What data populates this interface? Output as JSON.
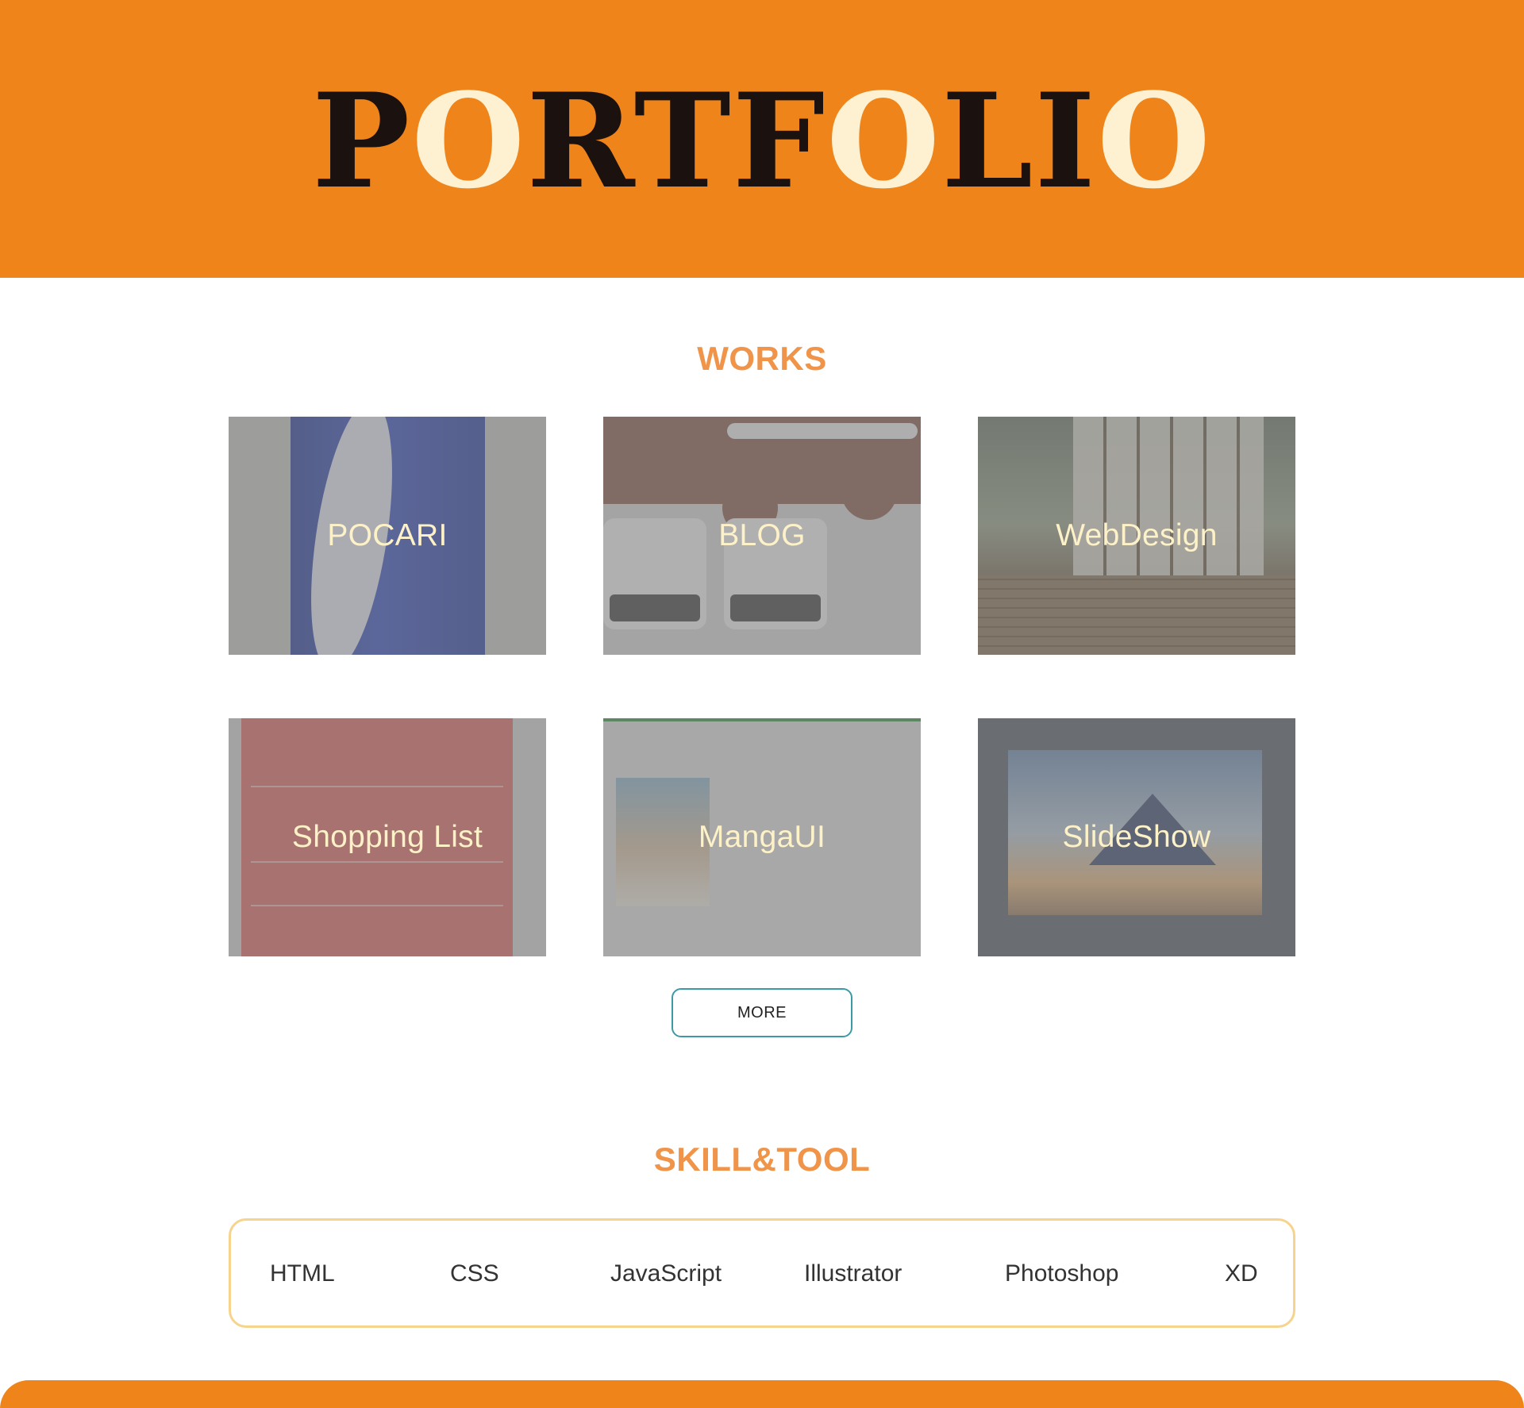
{
  "header": {
    "title_parts": [
      {
        "text": "P",
        "highlight": false
      },
      {
        "text": "O",
        "highlight": true
      },
      {
        "text": "RTF",
        "highlight": false
      },
      {
        "text": "O",
        "highlight": true
      },
      {
        "text": "LI",
        "highlight": false
      },
      {
        "text": "O",
        "highlight": true
      }
    ]
  },
  "works": {
    "title": "WORKS",
    "items": [
      {
        "label": "POCARI"
      },
      {
        "label": "BLOG"
      },
      {
        "label": "WebDesign"
      },
      {
        "label": "Shopping List"
      },
      {
        "label": "MangaUI"
      },
      {
        "label": "SlideShow"
      }
    ],
    "more_label": "MORE"
  },
  "skills": {
    "title": "SKILL&TOOL",
    "items": [
      "HTML",
      "CSS",
      "JavaScript",
      "Illustrator",
      "Photoshop",
      "XD"
    ]
  },
  "colors": {
    "brand_orange": "#ef841b",
    "heading_orange": "#f0944a",
    "title_dark": "#1b1210",
    "title_highlight": "#fdf1d2",
    "button_border": "#3d9aa5",
    "skills_border": "#f7d48e"
  }
}
